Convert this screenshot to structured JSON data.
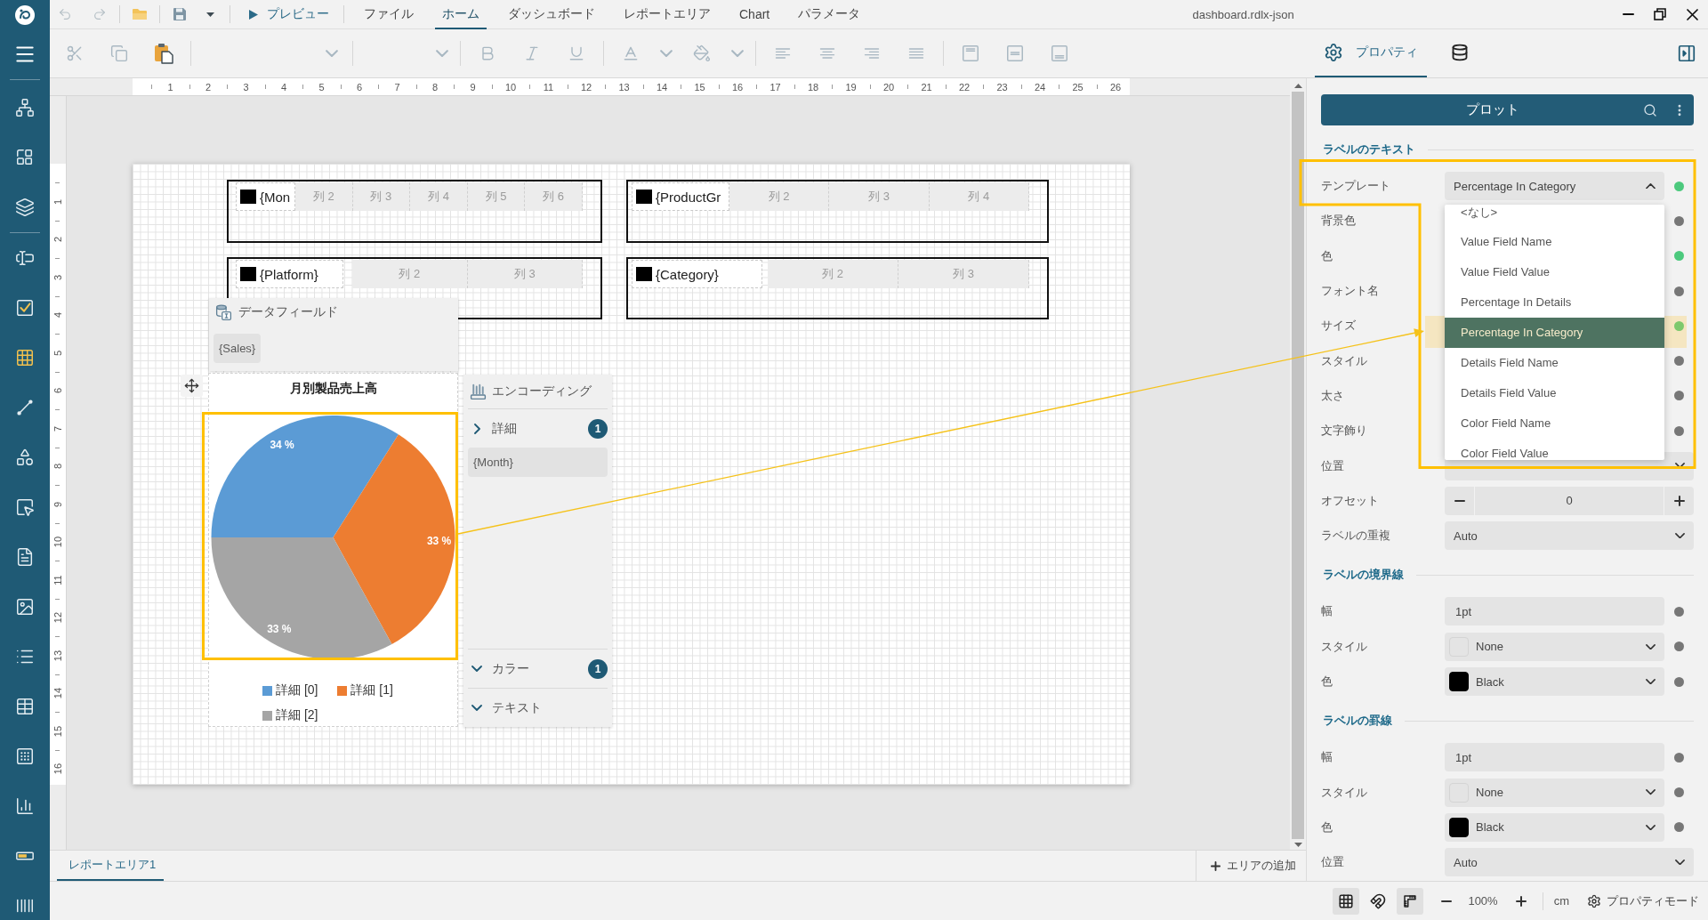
{
  "title_bar": {
    "undo_enabled": false,
    "redo_enabled": false,
    "preview_label": "プレビュー",
    "menu": [
      {
        "label": "ファイル",
        "selected": false
      },
      {
        "label": "ホーム",
        "selected": true
      },
      {
        "label": "ダッシュボード",
        "selected": false
      },
      {
        "label": "レポートエリア",
        "selected": false
      },
      {
        "label": "Chart",
        "selected": false
      },
      {
        "label": "パラメータ",
        "selected": false
      }
    ],
    "document_title": "dashboard.rdlx-json"
  },
  "toolbar": {
    "cut_enabled": false,
    "copy_enabled": false,
    "paste_enabled": true,
    "format_enabled": false
  },
  "panel_tabs": [
    {
      "kind": "properties",
      "label": "プロパティ",
      "selected": true
    },
    {
      "kind": "data",
      "selected": false
    }
  ],
  "ruler": {
    "horizontal": [
      "1",
      "2",
      "3",
      "4",
      "5",
      "6",
      "7",
      "8",
      "9",
      "10",
      "11",
      "12",
      "13",
      "14",
      "15",
      "16",
      "17",
      "18",
      "19",
      "20",
      "21",
      "22",
      "23",
      "24",
      "25",
      "26"
    ],
    "vertical": [
      "1",
      "2",
      "3",
      "4",
      "5",
      "6",
      "7",
      "8",
      "9",
      "10",
      "11",
      "12",
      "13",
      "14",
      "15",
      "16"
    ]
  },
  "report": {
    "tables": [
      {
        "first_cell": "{Mon",
        "columns": [
          "列 2",
          "列 3",
          "列 4",
          "列 5",
          "列 6"
        ]
      },
      {
        "first_cell": "{ProductGr",
        "columns": [
          "列 2",
          "列 3",
          "列 4"
        ]
      },
      {
        "first_cell": "{Platform}",
        "columns": [
          "列 2",
          "列 3"
        ]
      },
      {
        "first_cell": "{Category}",
        "columns": [
          "列 2",
          "列 3"
        ]
      }
    ],
    "data_field_panel": {
      "title": "データフィールド",
      "fields": [
        "{Sales}"
      ]
    },
    "chart": {
      "chart_data": {
        "type": "pie",
        "title": "月別製品売上高",
        "categories": [
          "詳細 [0]",
          "詳細 [1]",
          "詳細 [2]"
        ],
        "values": [
          34,
          33,
          33
        ],
        "colors": [
          "#5b9bd5",
          "#ed7d31",
          "#a5a5a5"
        ],
        "value_labels": [
          "34 %",
          "33 %",
          "33 %"
        ],
        "legend": "bottom"
      }
    },
    "encoding_panel": {
      "title": "エンコーディング",
      "sections": [
        {
          "label": "詳細",
          "expanded": false,
          "count": "1",
          "items": [
            "{Month}"
          ]
        },
        {
          "label": "カラー",
          "expanded": true,
          "count": "1"
        },
        {
          "label": "テキスト",
          "expanded": true
        }
      ]
    }
  },
  "bottom_tabs": {
    "tabs": [
      {
        "label": "レポートエリア1",
        "selected": true
      }
    ],
    "add_label": "エリアの追加"
  },
  "properties": {
    "title": "プロット",
    "sections": [
      {
        "title": "ラベルのテキスト",
        "rows": [
          {
            "label": "テンプレート",
            "modified": true,
            "field": {
              "kind": "select",
              "value": "Percentage In Category",
              "expanded": true,
              "options": [
                {
                  "label": "<なし>",
                  "selected": false
                },
                {
                  "label": "Value Field Name",
                  "selected": false
                },
                {
                  "label": "Value Field Value",
                  "selected": false
                },
                {
                  "label": "Percentage In Details",
                  "selected": false
                },
                {
                  "label": "Percentage In Category",
                  "selected": true
                },
                {
                  "label": "Details Field Name",
                  "selected": false
                },
                {
                  "label": "Details Field Value",
                  "selected": false
                },
                {
                  "label": "Color Field Name",
                  "selected": false
                },
                {
                  "label": "Color Field Value",
                  "selected": false
                }
              ]
            }
          },
          {
            "label": "背景色",
            "modified": false
          },
          {
            "label": "色",
            "modified": true
          },
          {
            "label": "フォント名",
            "modified": false
          },
          {
            "label": "サイズ",
            "modified": true
          },
          {
            "label": "スタイル",
            "modified": false
          },
          {
            "label": "太さ",
            "modified": false
          },
          {
            "label": "文字飾り",
            "modified": false
          },
          {
            "label": "位置",
            "field": {
              "kind": "select",
              "expanded": false
            }
          },
          {
            "label": "オフセット",
            "field": {
              "kind": "stepper",
              "value": "0"
            }
          },
          {
            "label": "ラベルの重複",
            "field": {
              "kind": "select",
              "value": "Auto",
              "expanded": false
            }
          }
        ]
      },
      {
        "title": "ラベルの境界線",
        "rows": [
          {
            "label": "幅",
            "modified": false,
            "field": {
              "kind": "text",
              "value": "1pt"
            }
          },
          {
            "label": "スタイル",
            "modified": false,
            "field": {
              "kind": "swatch",
              "value": "None"
            }
          },
          {
            "label": "色",
            "modified": false,
            "field": {
              "kind": "swatch",
              "value": "Black",
              "color": "#000000"
            }
          }
        ]
      },
      {
        "title": "ラベルの罫線",
        "rows": [
          {
            "label": "幅",
            "modified": false,
            "field": {
              "kind": "text",
              "value": "1pt"
            }
          },
          {
            "label": "スタイル",
            "modified": false,
            "field": {
              "kind": "swatch",
              "value": "None"
            }
          },
          {
            "label": "色",
            "modified": false,
            "field": {
              "kind": "swatch",
              "value": "Black",
              "color": "#000000"
            }
          },
          {
            "label": "位置",
            "field": {
              "kind": "select",
              "value": "Auto",
              "expanded": false
            }
          }
        ]
      }
    ]
  },
  "status_bar": {
    "grid_on": true,
    "snap_on": false,
    "rulers_on": true,
    "zoom": "100%",
    "unit": "cm",
    "mode": "プロパティモード"
  }
}
